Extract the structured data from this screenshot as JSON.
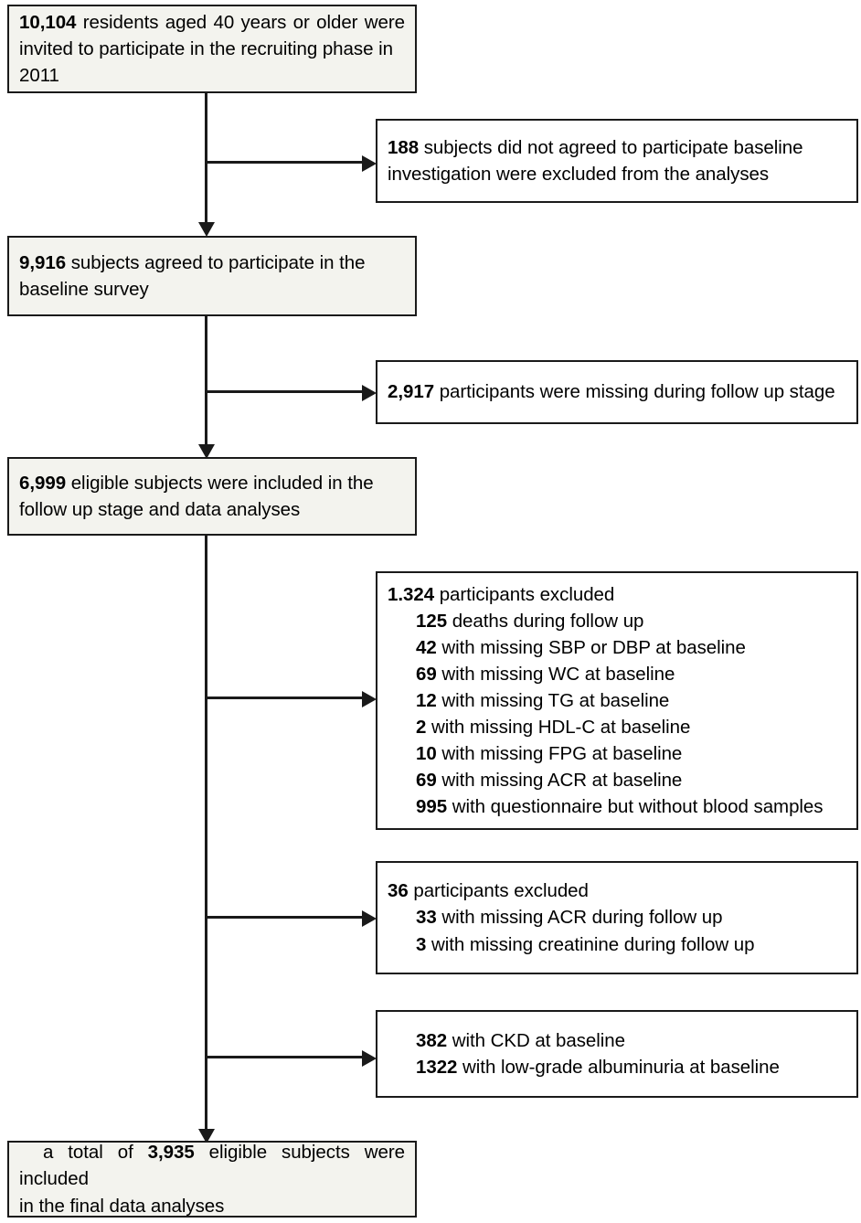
{
  "diagram": {
    "type": "participant-flow-diagram",
    "colors": {
      "stroke": "#1a1a1a",
      "main_box_fill": "#f3f3ee",
      "side_box_fill": "#ffffff",
      "text": "#000000"
    },
    "main_chain": [
      {
        "id": "recruit",
        "count": "10,104",
        "line1_rest": " residents aged 40 years or older were",
        "line2": "invited to participate in the recruiting phase in",
        "line3": "2011"
      },
      {
        "id": "baseline",
        "count": "9,916",
        "line1_rest": " subjects agreed to participate in the",
        "line2": "baseline survey"
      },
      {
        "id": "eligible",
        "count": "6,999",
        "line1_rest": " eligible subjects were included in the",
        "line2": "follow up stage and data analyses"
      },
      {
        "id": "final",
        "pre": "a total of ",
        "count": "3,935",
        "line1_rest": " eligible subjects were included",
        "line2": "in the final data analyses"
      }
    ],
    "exclusions": [
      {
        "id": "excl-not-agreed",
        "count": "188",
        "line1_rest": " subjects did not agreed to participate baseline",
        "line2": "investigation were excluded from the analyses"
      },
      {
        "id": "excl-missing-followup",
        "count": "2,917",
        "line1_rest": " participants were missing during follow up stage"
      },
      {
        "id": "excl-baseline-batch",
        "count": "1.324",
        "line1_rest": " participants excluded",
        "items": [
          {
            "count": "125",
            "text": " deaths during follow up"
          },
          {
            "count": "42",
            "text": " with missing SBP or DBP at baseline"
          },
          {
            "count": "69",
            "text": " with missing WC at baseline"
          },
          {
            "count": "12",
            "text": " with missing TG at baseline"
          },
          {
            "count": "2",
            "text": " with missing HDL-C at baseline"
          },
          {
            "count": "10",
            "text": " with missing FPG at baseline"
          },
          {
            "count": "69",
            "text": " with missing ACR at baseline"
          },
          {
            "count": "995",
            "text": " with questionnaire but without  blood samples"
          }
        ]
      },
      {
        "id": "excl-followup-batch",
        "count": "36",
        "line1_rest": " participants excluded",
        "items": [
          {
            "count": "33",
            "text": " with missing ACR during follow up"
          },
          {
            "count": "3",
            "text": " with missing creatinine during follow up"
          }
        ]
      },
      {
        "id": "excl-ckd-albuminuria",
        "items": [
          {
            "count": "382",
            "text": " with CKD at baseline"
          },
          {
            "count": "1322",
            "text": " with low-grade albuminuria at baseline"
          }
        ]
      }
    ]
  }
}
